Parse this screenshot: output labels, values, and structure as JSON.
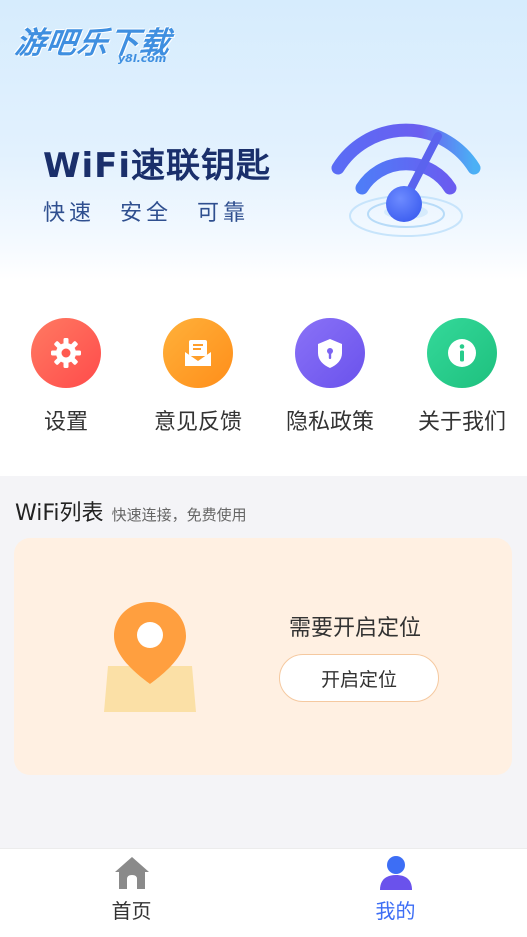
{
  "watermark": {
    "text": "游吧乐下载",
    "sub": "y8l.com"
  },
  "hero": {
    "title": "WiFi速联钥匙",
    "slogan": "快速 安全 可靠"
  },
  "menu": {
    "items": [
      {
        "label": "设置",
        "icon": "gear-icon",
        "color": "#ff6257"
      },
      {
        "label": "意见反馈",
        "icon": "mail-icon",
        "color": "#ffa22a"
      },
      {
        "label": "隐私政策",
        "icon": "shield-icon",
        "color": "#7b63f2"
      },
      {
        "label": "关于我们",
        "icon": "info-icon",
        "color": "#27cc8b"
      }
    ]
  },
  "wifi_list": {
    "title": "WiFi列表",
    "subtitle": "快速连接，免费使用"
  },
  "location_card": {
    "message": "需要开启定位",
    "button_label": "开启定位"
  },
  "tabbar": {
    "tabs": [
      {
        "label": "首页",
        "icon": "home-icon",
        "active": false,
        "color": "#333333"
      },
      {
        "label": "我的",
        "icon": "user-icon",
        "active": true,
        "color": "#3d6ef5"
      }
    ]
  },
  "colors": {
    "accent": "#3d6ef5",
    "title_dark": "#1a2f6b",
    "card_bg": "#fff0e2"
  }
}
